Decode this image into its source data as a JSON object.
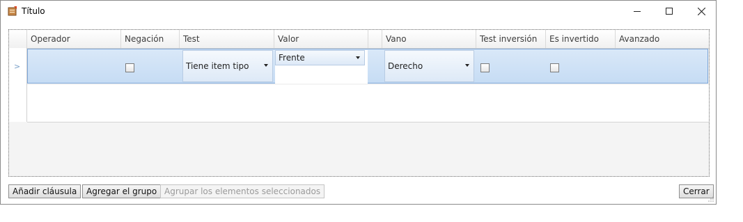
{
  "window": {
    "title": "Título"
  },
  "columns": [
    "Operador",
    "Negación",
    "Test",
    "Valor",
    "",
    "Vano",
    "Test inversión",
    "Es invertido",
    "Avanzado"
  ],
  "row": {
    "indicator": ">",
    "operador": "",
    "negacion_checked": false,
    "test": "Tiene item tipo",
    "valor": "Frente",
    "valor_input": "",
    "vano": "Derecho",
    "test_inversion_checked": false,
    "es_invertido_checked": false,
    "avanzado": ""
  },
  "buttons": {
    "add_clause": "Añadir cláusula",
    "add_group": "Agregar el grupo",
    "group_selected": "Agrupar los elementos seleccionados",
    "close": "Cerrar"
  },
  "icons": {
    "app": "document-edit-icon",
    "minimize": "minimize-icon",
    "maximize": "maximize-icon",
    "close": "close-icon"
  },
  "colors": {
    "selected_row": "#c6dcf4",
    "selected_border": "#7ea7d8",
    "combo_bg": "#dde9f7"
  }
}
